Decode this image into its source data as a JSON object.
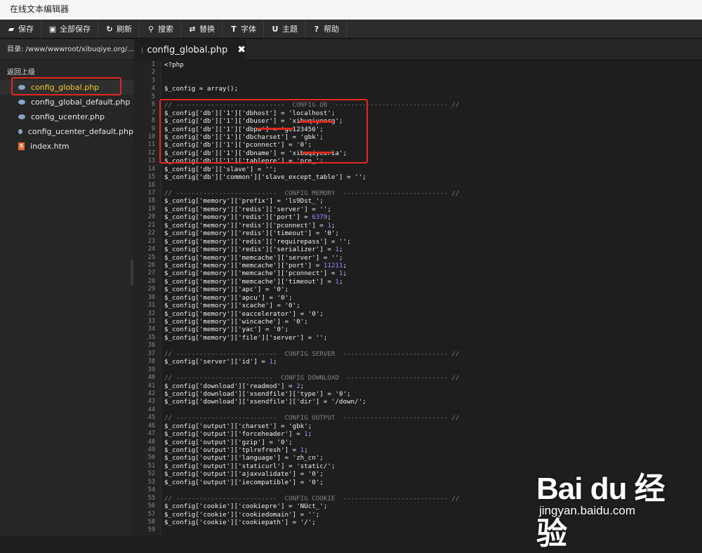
{
  "window": {
    "title": "在线文本编辑器"
  },
  "toolbar": {
    "buttons": [
      {
        "icon": "save-icon",
        "label": "保存"
      },
      {
        "icon": "save-all-icon",
        "label": "全部保存"
      },
      {
        "icon": "refresh-icon",
        "label": "刷新"
      },
      {
        "icon": "search-icon",
        "label": "搜索"
      },
      {
        "icon": "replace-icon",
        "label": "替换"
      },
      {
        "icon": "font-icon",
        "label": "字体"
      },
      {
        "icon": "theme-icon",
        "label": "主题"
      },
      {
        "icon": "help-icon",
        "label": "帮助"
      }
    ]
  },
  "pathbar": {
    "text": "目录: /www/wwwroot/xibuqiye.org/..."
  },
  "tab": {
    "label": "config_global.php",
    "close": "✖"
  },
  "sidebar": {
    "up_label": "返回上级",
    "files": [
      {
        "name": "config_global.php",
        "type": "php",
        "active": true
      },
      {
        "name": "config_global_default.php",
        "type": "php",
        "active": false
      },
      {
        "name": "config_ucenter.php",
        "type": "php",
        "active": false
      },
      {
        "name": "config_ucenter_default.php",
        "type": "php",
        "active": false
      },
      {
        "name": "index.htm",
        "type": "html",
        "active": false
      }
    ]
  },
  "collapse_glyph": "‹",
  "editor": {
    "lines": [
      "<?php",
      "",
      "",
      "$_config = array();",
      "",
      "// ----------------------------  CONFIG DB  ----------------------------- //",
      "$_config['db']['1']['dbhost'] = 'localhost';",
      "$_config['db']['1']['dbuser'] = 'xibuqiyeorg';",
      "$_config['db']['1']['dbpw'] = 'gc123456';",
      "$_config['db']['1']['dbcharset'] = 'gbk';",
      "$_config['db']['1']['pconnect'] = '0';",
      "$_config['db']['1']['dbname'] = 'xibuqiyeoria';",
      "$_config['db']['1']['tablepre'] = 'pre_';",
      "$_config['db']['slave'] = '';",
      "$_config['db']['common']['slave_except_table'] = '';",
      "",
      "// --------------------------  CONFIG MEMORY  --------------------------- //",
      "$_config['memory']['prefix'] = 'ls9Dst_';",
      "$_config['memory']['redis']['server'] = '';",
      "$_config['memory']['redis']['port'] = 6379;",
      "$_config['memory']['redis']['pconnect'] = 1;",
      "$_config['memory']['redis']['timeout'] = '0';",
      "$_config['memory']['redis']['requirepass'] = '';",
      "$_config['memory']['redis']['serializer'] = 1;",
      "$_config['memory']['memcache']['server'] = '';",
      "$_config['memory']['memcache']['port'] = 11211;",
      "$_config['memory']['memcache']['pconnect'] = 1;",
      "$_config['memory']['memcache']['timeout'] = 1;",
      "$_config['memory']['apc'] = '0';",
      "$_config['memory']['apcu'] = '0';",
      "$_config['memory']['xcache'] = '0';",
      "$_config['memory']['eaccelerator'] = '0';",
      "$_config['memory']['wincache'] = '0';",
      "$_config['memory']['yac'] = '0';",
      "$_config['memory']['file']['server'] = '';",
      "",
      "// --------------------------  CONFIG SERVER  --------------------------- //",
      "$_config['server']['id'] = 1;",
      "",
      "// -------------------------  CONFIG DOWNLOAD  -------------------------- //",
      "$_config['download']['readmod'] = 2;",
      "$_config['download']['xsendfile']['type'] = '0';",
      "$_config['download']['xsendfile']['dir'] = '/down/';",
      "",
      "// --------------------------  CONFIG OUTPUT  --------------------------- //",
      "$_config['output']['charset'] = 'gbk';",
      "$_config['output']['forceheader'] = 1;",
      "$_config['output']['gzip'] = '0';",
      "$_config['output']['tplrefresh'] = 1;",
      "$_config['output']['language'] = 'zh_cn';",
      "$_config['output']['staticurl'] = 'static/';",
      "$_config['output']['ajaxvalidate'] = '0';",
      "$_config['output']['iecompatible'] = '0';",
      "",
      "// --------------------------  CONFIG COOKIE  --------------------------- //",
      "$_config['cookie']['cookiepre'] = 'NUct_';",
      "$_config['cookie']['cookiedomain'] = '';",
      "$_config['cookie']['cookiepath'] = '/';",
      ""
    ]
  },
  "watermark": {
    "logo": "Bai du 经验",
    "url": "jingyan.baidu.com"
  },
  "colors": {
    "accent": "#f4c72a",
    "highlight": "#e0281f",
    "number": "#ae81ff",
    "comment": "#7f7f7f"
  }
}
